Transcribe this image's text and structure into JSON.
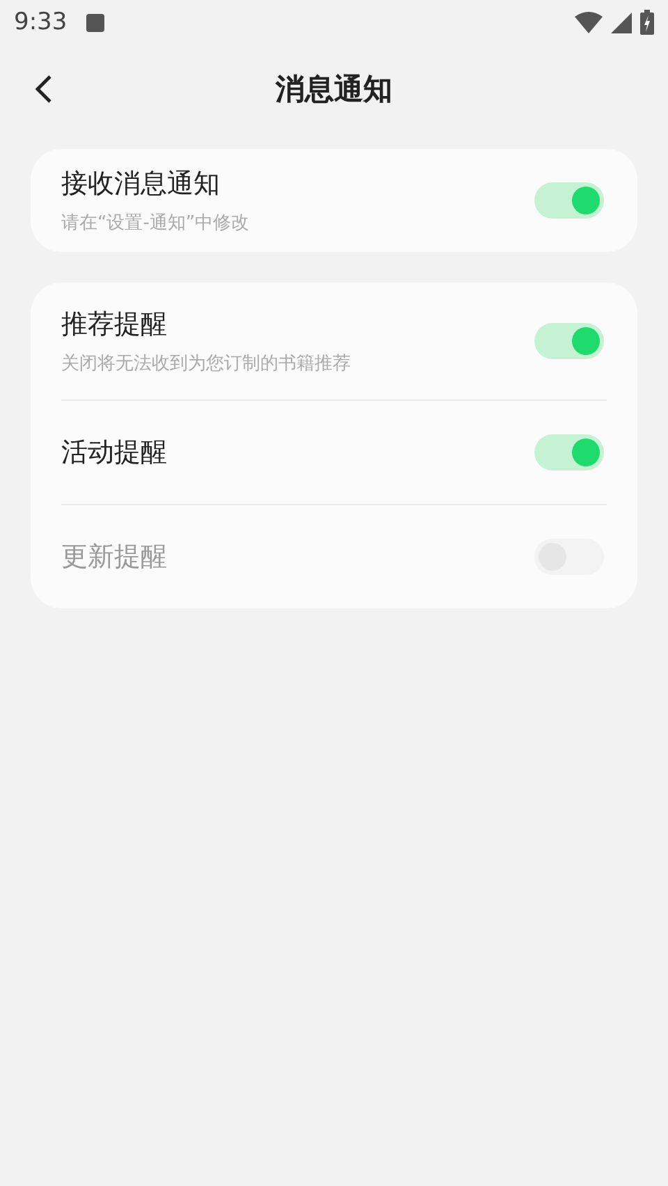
{
  "status_bar": {
    "time": "9:33"
  },
  "header": {
    "title": "消息通知"
  },
  "groups": [
    {
      "items": [
        {
          "title": "接收消息通知",
          "subtitle": "请在“设置-通知”中修改",
          "on": true,
          "disabled": false
        }
      ]
    },
    {
      "items": [
        {
          "title": "推荐提醒",
          "subtitle": "关闭将无法收到为您订制的书籍推荐",
          "on": true,
          "disabled": false
        },
        {
          "title": "活动提醒",
          "on": true,
          "disabled": false
        },
        {
          "title": "更新提醒",
          "on": false,
          "disabled": true
        }
      ]
    }
  ]
}
